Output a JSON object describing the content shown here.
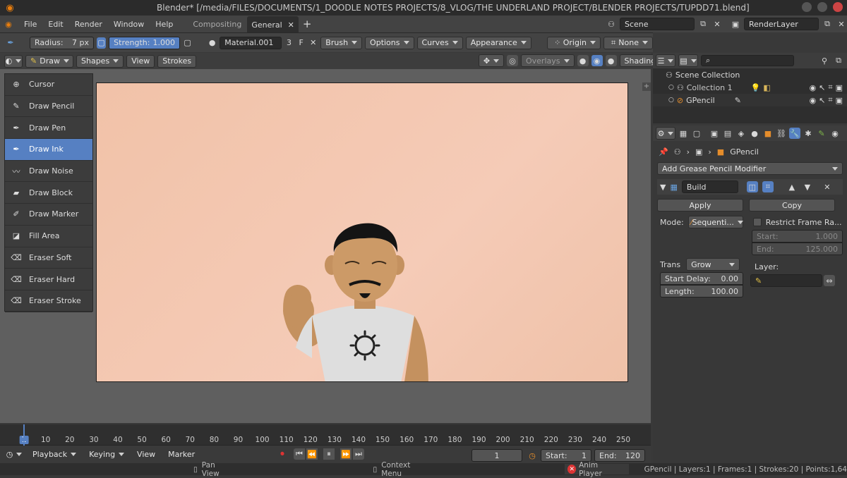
{
  "title_bar": {
    "text": "Blender* [/media/FILES/DOCUMENTS/1_DOODLE NOTES PROJECTS/8_VLOG/THE UNDERLAND PROJECT/BLENDER PROJECTS/TUPDD71.blend]"
  },
  "menu": {
    "items": [
      "File",
      "Edit",
      "Render",
      "Window",
      "Help"
    ]
  },
  "workspace_tabs": [
    {
      "label": "Compositing"
    },
    {
      "label": "General"
    }
  ],
  "scene": {
    "label": "Scene"
  },
  "render_layer": {
    "label": "RenderLayer"
  },
  "tool_settings": {
    "radius_label": "Radius:",
    "radius_value": "7 px",
    "strength_label": "Strength:",
    "strength_value": "1.000",
    "strength_fraction": 1.0,
    "material": "Material.001",
    "material_users": "3",
    "fake_user": "F",
    "brush": "Brush",
    "options": "Options",
    "curves": "Curves",
    "appearance": "Appearance"
  },
  "transform": {
    "pivot": "Origin",
    "snap": "None"
  },
  "viewport_header": {
    "mode": "Draw",
    "shapes": "Shapes",
    "view": "View",
    "strokes": "Strokes",
    "overlays": "Overlays",
    "shading": "Shading"
  },
  "tools": [
    {
      "label": "Cursor",
      "icon": "cursor-icon"
    },
    {
      "label": "Draw Pencil",
      "icon": "pencil-icon"
    },
    {
      "label": "Draw Pen",
      "icon": "pen-icon"
    },
    {
      "label": "Draw Ink",
      "icon": "ink-icon",
      "active": true
    },
    {
      "label": "Draw Noise",
      "icon": "noise-icon"
    },
    {
      "label": "Draw Block",
      "icon": "block-icon"
    },
    {
      "label": "Draw Marker",
      "icon": "marker-icon"
    },
    {
      "label": "Fill Area",
      "icon": "fill-icon"
    },
    {
      "label": "Eraser Soft",
      "icon": "eraser-soft-icon"
    },
    {
      "label": "Eraser Hard",
      "icon": "eraser-hard-icon"
    },
    {
      "label": "Eraser Stroke",
      "icon": "eraser-stroke-icon"
    }
  ],
  "outliner": {
    "root": "Scene Collection",
    "items": [
      {
        "label": "Collection 1"
      },
      {
        "label": "GPencil"
      }
    ]
  },
  "properties": {
    "object_name": "GPencil",
    "add_modifier": "Add Grease Pencil Modifier",
    "modifier_name": "Build",
    "apply": "Apply",
    "copy": "Copy",
    "mode_label": "Mode:",
    "mode_value": "Sequenti...",
    "restrict_label": "Restrict Frame Ra...",
    "start_label": "Start:",
    "start_value": "1.000",
    "end_label": "End:",
    "end_value": "125.000",
    "trans_label": "Trans",
    "trans_value": "Grow",
    "start_delay_label": "Start Delay:",
    "start_delay_value": "0.00",
    "length_label": "Length:",
    "length_value": "100.00",
    "layer_label": "Layer:"
  },
  "timeline": {
    "ticks": [
      "1",
      "10",
      "20",
      "30",
      "40",
      "50",
      "60",
      "70",
      "80",
      "90",
      "100",
      "110",
      "120",
      "130",
      "140",
      "150",
      "160",
      "170",
      "180",
      "190",
      "200",
      "210",
      "220",
      "230",
      "240",
      "250"
    ],
    "playback": "Playback",
    "keying": "Keying",
    "view": "View",
    "marker": "Marker",
    "current_frame": "1",
    "start_label": "Start:",
    "start_value": "1",
    "end_label": "End:",
    "end_value": "120"
  },
  "status": {
    "pan": "Pan View",
    "context": "Context Menu",
    "anim": "Anim Player",
    "info": "GPencil | Layers:1 | Frames:1 | Strokes:20 | Points:1,64"
  },
  "colors": {
    "accent": "#5680c2",
    "canvas": "#f2c4ac",
    "error": "#d33"
  }
}
